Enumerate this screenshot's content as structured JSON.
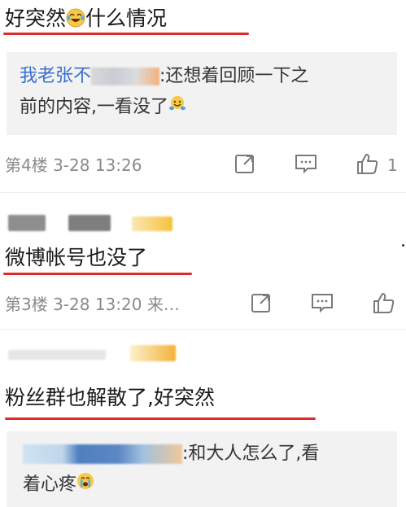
{
  "top_post": {
    "text_a": "好突然",
    "text_b": "什么情况",
    "emoji_icon": "laughing-crying-face-icon"
  },
  "reply_4": {
    "username": "我老张不",
    "text_line1": ":还想着回顾一下之",
    "text_line2": "前的内容,一看没了",
    "emoji_icon": "hugging-face-icon",
    "meta": "第4楼 3-28 13:26",
    "like_count": "1"
  },
  "floor_3": {
    "comment": "微博帐号也没了",
    "meta": "第3楼 3-28 13:20 来…"
  },
  "floor_2": {
    "comment": "粉丝群也解散了,好突然",
    "reply_text_line1": ":和大人怎么了,看",
    "reply_text_line2": "着心疼",
    "emoji_icon": "crying-face-icon"
  },
  "colors": {
    "underline": "#e02a2a",
    "username": "#3a6fd0",
    "quote_bg": "#f2f2f2",
    "meta": "#8a8a8a"
  }
}
